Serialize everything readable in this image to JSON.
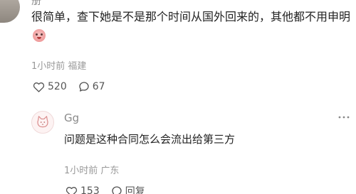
{
  "main_comment": {
    "author": "册",
    "text": "很简单，查下她是不是那个时间从国外回来的，其他都不用申明",
    "emoji_icon": "crying-face-emoji",
    "time": "1小时前",
    "location": "福建",
    "likes": "520",
    "comments": "67"
  },
  "reply": {
    "author": "Gg",
    "text": "问题是这种合同怎么会流出给第三方",
    "time": "1小时前",
    "location": "广东",
    "likes": "153",
    "reply_label": "回复"
  },
  "icons": {
    "like": "heart-icon",
    "comment": "comment-bubble-icon",
    "more": "more-dots-icon"
  },
  "colors": {
    "text": "#222222",
    "meta": "#9a9a9a",
    "action": "#555555"
  }
}
